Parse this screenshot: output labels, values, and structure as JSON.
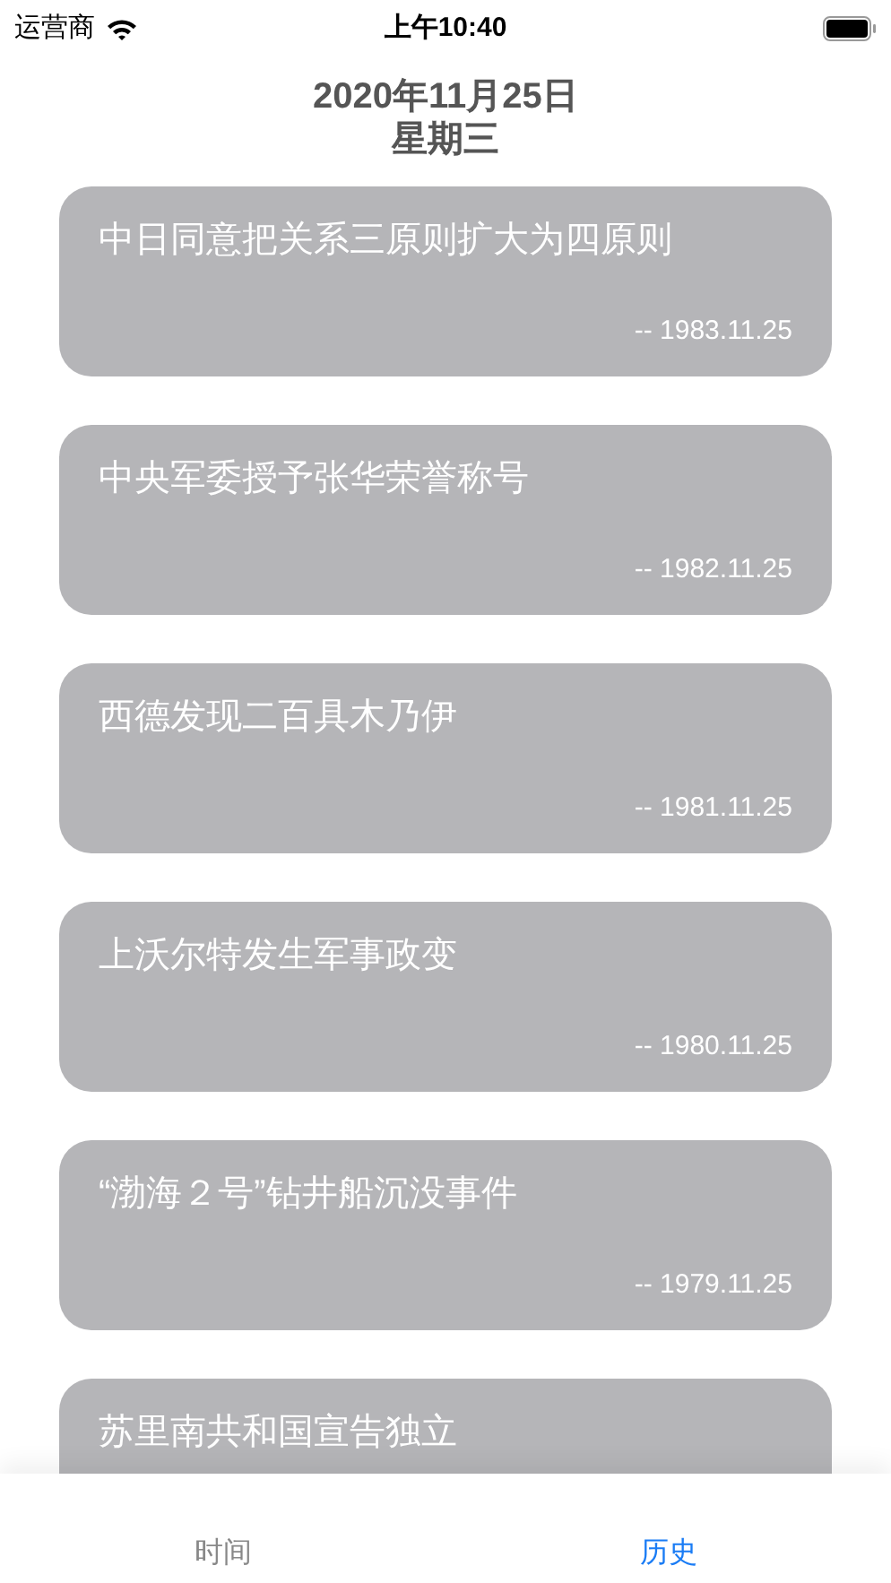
{
  "status_bar": {
    "carrier": "运营商",
    "time": "上午10:40"
  },
  "header": {
    "date": "2020年11月25日",
    "weekday": "星期三"
  },
  "events": [
    {
      "title": "中日同意把关系三原则扩大为四原则",
      "date": "-- 1983.11.25"
    },
    {
      "title": "中央军委授予张华荣誉称号",
      "date": "-- 1982.11.25"
    },
    {
      "title": "西德发现二百具木乃伊",
      "date": "-- 1981.11.25"
    },
    {
      "title": "上沃尔特发生军事政变",
      "date": "-- 1980.11.25"
    },
    {
      "title": "“渤海２号”钻井船沉没事件",
      "date": "-- 1979.11.25"
    },
    {
      "title": "苏里南共和国宣告独立"
    }
  ],
  "tabs": [
    {
      "label": "时间",
      "selected": false
    },
    {
      "label": "历史",
      "selected": true
    }
  ]
}
